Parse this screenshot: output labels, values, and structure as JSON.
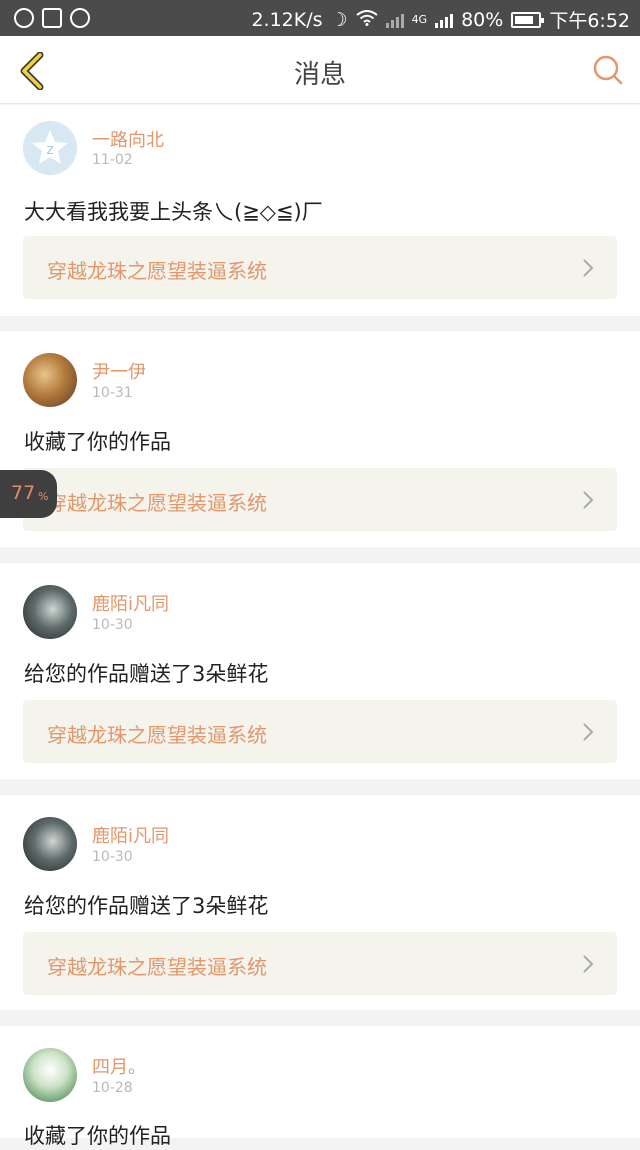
{
  "status_bar": {
    "net_speed": "2.12K/s",
    "net_label": "4G",
    "battery_text": "80%",
    "battery_level": 0.8,
    "time": "下午6:52"
  },
  "header": {
    "title": "消息",
    "back_icon": "back-chevron-icon",
    "search_icon": "search-icon"
  },
  "colors": {
    "accent": "#e3976a",
    "card_work_bg": "#f4f3ec",
    "status_bar_bg": "#4b4b4b"
  },
  "messages": [
    {
      "user": "一路向北",
      "date": "11-02",
      "text": "大大看我我要上头条乀(≧◇≦)厂",
      "work": "穿越龙珠之愿望装逼系统",
      "avatar": "qzone-logo-avatar"
    },
    {
      "user": "尹一伊",
      "date": "10-31",
      "text": "收藏了你的作品",
      "work": "穿越龙珠之愿望装逼系统",
      "avatar": "photo-avatar"
    },
    {
      "user": "鹿陌i凡同",
      "date": "10-30",
      "text": "给您的作品赠送了3朵鲜花",
      "work": "穿越龙珠之愿望装逼系统",
      "avatar": "photo-avatar"
    },
    {
      "user": "鹿陌i凡同",
      "date": "10-30",
      "text": "给您的作品赠送了3朵鲜花",
      "work": "穿越龙珠之愿望装逼系统",
      "avatar": "photo-avatar"
    },
    {
      "user": "四月。",
      "date": "10-28",
      "text": "收藏了你的作品",
      "avatar": "photo-avatar"
    }
  ],
  "floating_badge": {
    "value": "77",
    "unit": "%"
  }
}
